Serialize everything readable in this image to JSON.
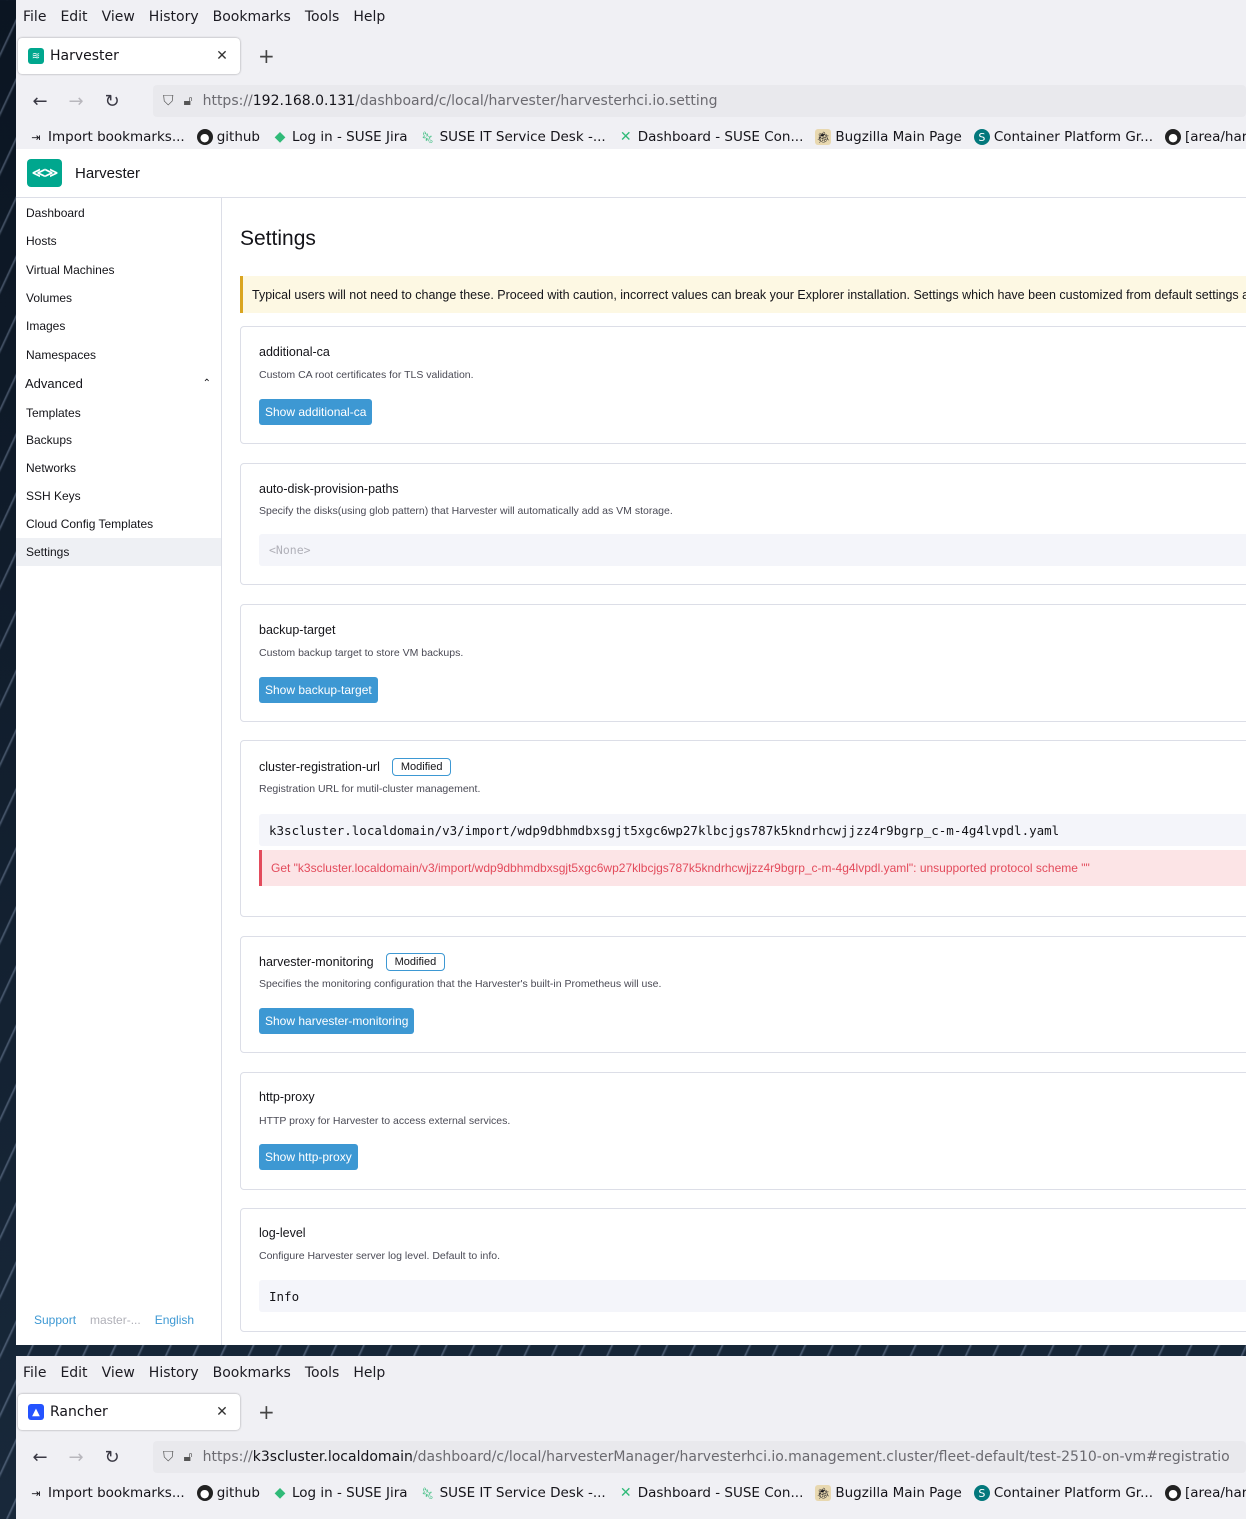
{
  "menu": [
    "File",
    "Edit",
    "View",
    "History",
    "Bookmarks",
    "Tools",
    "Help"
  ],
  "window1": {
    "tab_title": "Harvester",
    "url_prefix": "https://",
    "url_host": "192.168.0.131",
    "url_path": "/dashboard/c/local/harvester/harvesterhci.io.setting"
  },
  "window2": {
    "tab_title": "Rancher",
    "url_prefix": "https://",
    "url_host": "k3scluster.localdomain",
    "url_path": "/dashboard/c/local/harvesterManager/harvesterhci.io.management.cluster/fleet-default/test-2510-on-vm#registratio"
  },
  "bookmarks": [
    {
      "label": "Import bookmarks...",
      "icon": "import-icon"
    },
    {
      "label": "github",
      "icon": "github-icon"
    },
    {
      "label": "Log in - SUSE Jira",
      "icon": "jira-icon"
    },
    {
      "label": "SUSE IT Service Desk -...",
      "icon": "suse-chameleon-icon"
    },
    {
      "label": "Dashboard - SUSE Con...",
      "icon": "confluence-icon"
    },
    {
      "label": "Bugzilla Main Page",
      "icon": "bugzilla-icon"
    },
    {
      "label": "Container Platform Gr...",
      "icon": "sharepoint-icon"
    },
    {
      "label": "[area/harvester] failu...",
      "icon": "github-icon"
    }
  ],
  "app": {
    "title": "Harvester",
    "nav": {
      "items": [
        "Dashboard",
        "Hosts",
        "Virtual Machines",
        "Volumes",
        "Images",
        "Namespaces"
      ],
      "group": "Advanced",
      "sub_items": [
        "Templates",
        "Backups",
        "Networks",
        "SSH Keys",
        "Cloud Config Templates",
        "Settings"
      ]
    },
    "footer": {
      "support": "Support",
      "version": "master-...",
      "language": "English"
    },
    "page_title": "Settings",
    "banner": "Typical users will not need to change these. Proceed with caution, incorrect values can break your Explorer installation. Settings which have been customized from default settings are ta",
    "settings": {
      "additional_ca": {
        "name": "additional-ca",
        "desc": "Custom CA root certificates for TLS validation.",
        "button": "Show additional-ca"
      },
      "auto_disk": {
        "name": "auto-disk-provision-paths",
        "desc": "Specify the disks(using glob pattern) that Harvester will automatically add as VM storage.",
        "value": "<None>"
      },
      "backup_target": {
        "name": "backup-target",
        "desc": "Custom backup target to store VM backups.",
        "button": "Show backup-target"
      },
      "cluster_reg": {
        "name": "cluster-registration-url",
        "badge": "Modified",
        "desc": "Registration URL for mutil-cluster management.",
        "value": "k3scluster.localdomain/v3/import/wdp9dbhmdbxsgjt5xgc6wp27klbcjgs787k5kndrhcwjjzz4r9bgrp_c-m-4g4lvpdl.yaml",
        "error": "Get \"k3scluster.localdomain/v3/import/wdp9dbhmdbxsgjt5xgc6wp27klbcjgs787k5kndrhcwjjzz4r9bgrp_c-m-4g4lvpdl.yaml\": unsupported protocol scheme \"\""
      },
      "monitoring": {
        "name": "harvester-monitoring",
        "badge": "Modified",
        "desc": "Specifies the monitoring configuration that the Harvester's built-in Prometheus will use.",
        "button": "Show harvester-monitoring"
      },
      "http_proxy": {
        "name": "http-proxy",
        "desc": "HTTP proxy for Harvester to access external services.",
        "button": "Show http-proxy"
      },
      "log_level": {
        "name": "log-level",
        "desc": "Configure Harvester server log level. Default to info.",
        "value": "Info"
      }
    }
  },
  "colors": {
    "accent": "#3d98d3",
    "brand": "#00a78e",
    "error": "#e34b5c",
    "warning": "#daa520"
  }
}
